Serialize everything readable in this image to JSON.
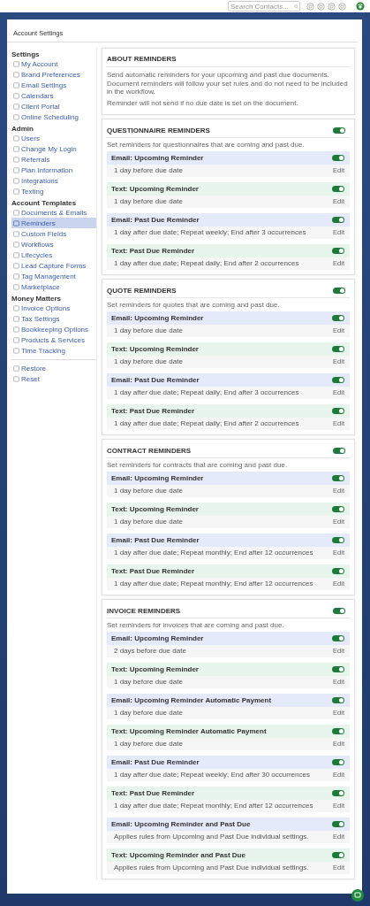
{
  "topbar": {
    "search": {
      "placeholder": "Search Contacts..."
    }
  },
  "page": {
    "title": "Account Settings"
  },
  "sidebar": {
    "groups": [
      {
        "heading": "Settings",
        "items": [
          {
            "label": "My Account",
            "selected": false
          },
          {
            "label": "Brand Preferences",
            "selected": false
          },
          {
            "label": "Email Settings",
            "selected": false
          },
          {
            "label": "Calendars",
            "selected": false
          },
          {
            "label": "Client Portal",
            "selected": false
          },
          {
            "label": "Online Scheduling",
            "selected": false
          }
        ]
      },
      {
        "heading": "Admin",
        "items": [
          {
            "label": "Users",
            "selected": false
          },
          {
            "label": "Change My Login",
            "selected": false
          },
          {
            "label": "Referrals",
            "selected": false
          },
          {
            "label": "Plan Information",
            "selected": false
          },
          {
            "label": "Integrations",
            "selected": false
          },
          {
            "label": "Texting",
            "selected": false
          }
        ]
      },
      {
        "heading": "Account Templates",
        "items": [
          {
            "label": "Documents & Emails",
            "selected": false
          },
          {
            "label": "Reminders",
            "selected": true
          },
          {
            "label": "Custom Fields",
            "selected": false
          },
          {
            "label": "Workflows",
            "selected": false
          },
          {
            "label": "Lifecycles",
            "selected": false
          },
          {
            "label": "Lead Capture Forms",
            "selected": false
          },
          {
            "label": "Tag Management",
            "selected": false
          },
          {
            "label": "Marketplace",
            "selected": false
          }
        ]
      },
      {
        "heading": "Money Matters",
        "items": [
          {
            "label": "Invoice Options",
            "selected": false
          },
          {
            "label": "Tax Settings",
            "selected": false
          },
          {
            "label": "Bookkeeping Options",
            "selected": false
          },
          {
            "label": "Products & Services",
            "selected": false
          },
          {
            "label": "Time Tracking",
            "selected": false
          }
        ]
      }
    ],
    "footer_items": [
      {
        "label": "Restore",
        "selected": false
      },
      {
        "label": "Reset",
        "selected": false
      }
    ]
  },
  "about": {
    "title": "ABOUT REMINDERS",
    "paragraphs": [
      "Send automatic reminders for your upcoming and past due documents. Document reminders will follow your set rules and do not need to be included in the workflow.",
      "Reminder will not send if no due date is set on the document."
    ]
  },
  "sections": [
    {
      "title": "QUESTIONNAIRE REMINDERS",
      "enabled": true,
      "description": "Set reminders for questionnaires that are coming and past due.",
      "reminders": [
        {
          "kind": "email",
          "title": "Email: Upcoming Reminder",
          "enabled": true,
          "detail": "1 day before due date",
          "action": "Edit"
        },
        {
          "kind": "text",
          "title": "Text: Upcoming Reminder",
          "enabled": true,
          "detail": "1 day before due date",
          "action": "Edit"
        },
        {
          "kind": "email",
          "title": "Email: Past Due Reminder",
          "enabled": true,
          "detail": "1 day after due date; Repeat weekly; End after 3 occurrences",
          "action": "Edit"
        },
        {
          "kind": "text",
          "title": "Text: Past Due Reminder",
          "enabled": true,
          "detail": "1 day after due date; Repeat daily; End after 2 occurrences",
          "action": "Edit"
        }
      ]
    },
    {
      "title": "QUOTE REMINDERS",
      "enabled": true,
      "description": "Set reminders for quotes that are coming and past due.",
      "reminders": [
        {
          "kind": "email",
          "title": "Email: Upcoming Reminder",
          "enabled": true,
          "detail": "1 day before due date",
          "action": "Edit"
        },
        {
          "kind": "text",
          "title": "Text: Upcoming Reminder",
          "enabled": true,
          "detail": "1 day before due date",
          "action": "Edit"
        },
        {
          "kind": "email",
          "title": "Email: Past Due Reminder",
          "enabled": true,
          "detail": "1 day after due date; Repeat daily; End after 3 occurrences",
          "action": "Edit"
        },
        {
          "kind": "text",
          "title": "Text: Past Due Reminder",
          "enabled": true,
          "detail": "1 day after due date; Repeat daily; End after 2 occurrences",
          "action": "Edit"
        }
      ]
    },
    {
      "title": "CONTRACT REMINDERS",
      "enabled": true,
      "description": "Set reminders for contracts that are coming and past due.",
      "reminders": [
        {
          "kind": "email",
          "title": "Email: Upcoming Reminder",
          "enabled": true,
          "detail": "1 day before due date",
          "action": "Edit"
        },
        {
          "kind": "text",
          "title": "Text: Upcoming Reminder",
          "enabled": true,
          "detail": "1 day before due date",
          "action": "Edit"
        },
        {
          "kind": "email",
          "title": "Email: Past Due Reminder",
          "enabled": true,
          "detail": "1 day after due date; Repeat monthly; End after 12 occurrences",
          "action": "Edit"
        },
        {
          "kind": "text",
          "title": "Text: Past Due Reminder",
          "enabled": true,
          "detail": "1 day after due date; Repeat monthly; End after 12 occurrences",
          "action": "Edit"
        }
      ]
    },
    {
      "title": "INVOICE REMINDERS",
      "enabled": true,
      "description": "Set reminders for invoices that are coming and past due.",
      "reminders": [
        {
          "kind": "email",
          "title": "Email: Upcoming Reminder",
          "enabled": true,
          "detail": "2 days before due date",
          "action": "Edit"
        },
        {
          "kind": "text",
          "title": "Text: Upcoming Reminder",
          "enabled": true,
          "detail": "1 day before due date",
          "action": "Edit"
        },
        {
          "kind": "email",
          "title": "Email: Upcoming Reminder Automatic Payment",
          "enabled": true,
          "detail": "1 day before due date",
          "action": "Edit"
        },
        {
          "kind": "text",
          "title": "Text: Upcoming Reminder Automatic Payment",
          "enabled": true,
          "detail": "1 day before due date",
          "action": "Edit"
        },
        {
          "kind": "email",
          "title": "Email: Past Due Reminder",
          "enabled": true,
          "detail": "1 day after due date; Repeat weekly; End after 30 occurrences",
          "action": "Edit"
        },
        {
          "kind": "text",
          "title": "Text: Past Due Reminder",
          "enabled": true,
          "detail": "1 day after due date; Repeat monthly; End after 12 occurrences",
          "action": "Edit"
        },
        {
          "kind": "email",
          "title": "Email: Upcoming Reminder and Past Due",
          "enabled": true,
          "detail": "Applies rules from Upcoming and Past Due individual settings.",
          "action": "Edit"
        },
        {
          "kind": "text",
          "title": "Text: Upcoming Reminder and Past Due",
          "enabled": true,
          "detail": "Applies rules from Upcoming and Past Due individual settings.",
          "action": "Edit"
        }
      ]
    }
  ]
}
